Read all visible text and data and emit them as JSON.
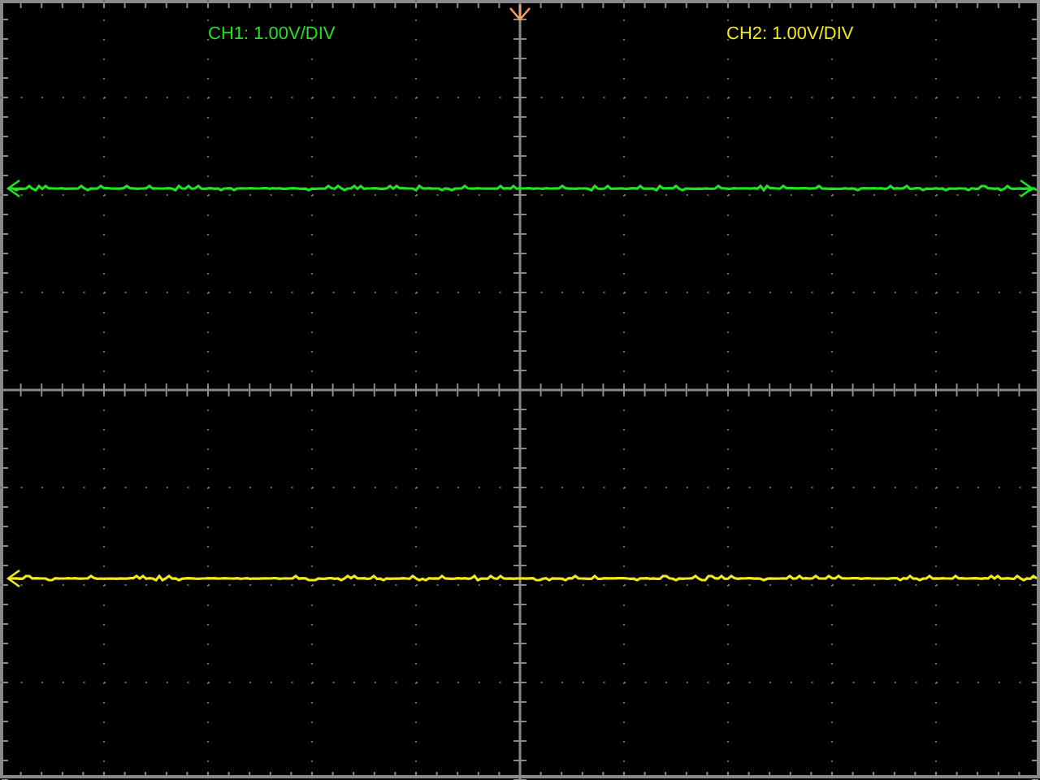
{
  "channels": [
    {
      "label": "CH1: 1.00V/DIV",
      "color": "#22e022"
    },
    {
      "label": "CH2: 1.00V/DIV",
      "color": "#f0e81c"
    }
  ]
}
